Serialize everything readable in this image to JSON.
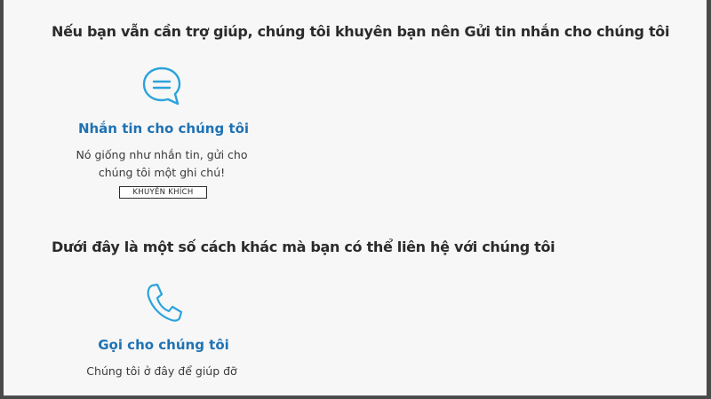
{
  "sections": [
    {
      "heading": "Nếu bạn vẫn cần trợ giúp, chúng tôi khuyên bạn nên Gửi tin nhắn cho chúng tôi",
      "card": {
        "icon": "chat-bubble-icon",
        "title": "Nhắn tin cho chúng tôi",
        "description_lines": [
          "Nó giống như nhắn tin, gửi cho",
          "chúng tôi một ghi chú!"
        ],
        "badge": "KHUYẾN KHÍCH"
      }
    },
    {
      "heading": "Dưới đây là một số cách khác mà bạn có thể liên hệ với chúng tôi",
      "card": {
        "icon": "phone-icon",
        "title": "Gọi cho chúng tôi",
        "description_lines": [
          "Chúng tôi ở đây để giúp đỡ"
        ]
      }
    }
  ],
  "colors": {
    "accent": "#1f72b4",
    "icon_stroke": "#2aa3db",
    "heading_text": "#2b2b2b",
    "body_text": "#3a3a3a",
    "background": "#f7f7f7"
  }
}
